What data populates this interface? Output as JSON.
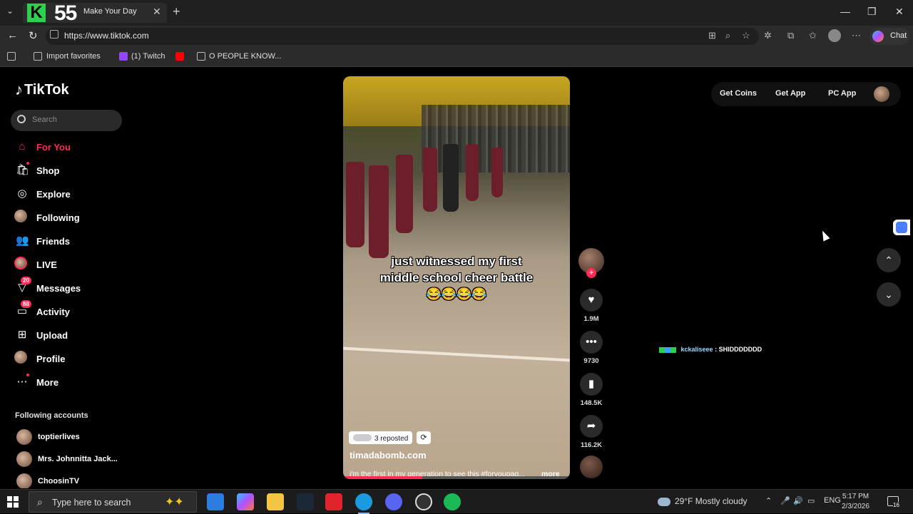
{
  "browser": {
    "tab_badge": "55",
    "tab_title": "Make Your Day",
    "url": "https://www.tiktok.com",
    "chat_label": "Chat",
    "favorites": [
      "Import favorites",
      "(1) Twitch",
      "O PEOPLE KNOW..."
    ]
  },
  "tiktok": {
    "logo": "TikTok",
    "search_placeholder": "Search",
    "nav": [
      {
        "label": "For You",
        "icon": "home-icon"
      },
      {
        "label": "Shop",
        "icon": "shop-icon"
      },
      {
        "label": "Explore",
        "icon": "explore-icon"
      },
      {
        "label": "Following",
        "icon": "following-icon"
      },
      {
        "label": "Friends",
        "icon": "friends-icon"
      },
      {
        "label": "LIVE",
        "icon": "live-icon"
      },
      {
        "label": "Messages",
        "icon": "messages-icon",
        "badge": "20"
      },
      {
        "label": "Activity",
        "icon": "activity-icon",
        "badge": "88"
      },
      {
        "label": "Upload",
        "icon": "upload-icon"
      },
      {
        "label": "Profile",
        "icon": "profile-icon"
      },
      {
        "label": "More",
        "icon": "more-icon"
      }
    ],
    "following_title": "Following accounts",
    "following": [
      "toptierlives",
      "Mrs. Johnnitta Jack...",
      "ChoosinTV"
    ],
    "top_actions": {
      "coins": "Get Coins",
      "app": "Get App",
      "pc": "PC App"
    },
    "video": {
      "caption_line1": "just witnessed my first",
      "caption_line2": "middle school cheer battle",
      "caption_emoji": "😂😂😂😂",
      "reposted": "3 reposted",
      "author": "timadabomb.com",
      "description": "i'm the first in my generation to see this #foryoupag...",
      "more": "more",
      "progress": 0.35
    },
    "actions": {
      "likes": "1.9M",
      "comments": "9730",
      "saves": "148.5K",
      "shares": "116.2K"
    },
    "chat_overlay": {
      "user": "kckaliseee",
      "message": ": SHIDDDDDDD"
    }
  },
  "taskbar": {
    "search_placeholder": "Type here to search",
    "weather": "29°F  Mostly cloudy",
    "language": "ENG",
    "time": "5:17 PM",
    "date": "2/3/2026",
    "notifications": "16"
  }
}
